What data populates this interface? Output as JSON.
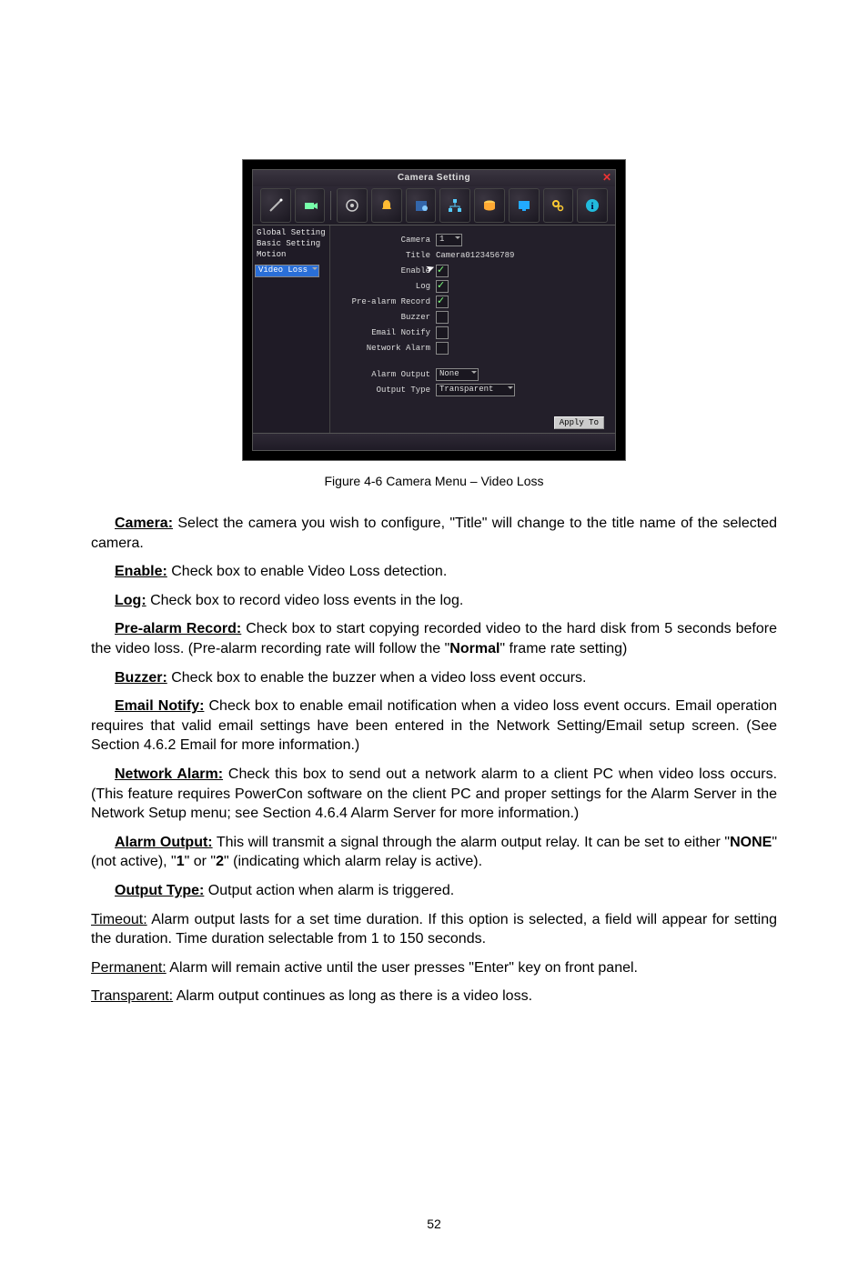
{
  "screenshot": {
    "title": "Camera Setting",
    "sidebar": [
      "Global Setting",
      "Basic Setting",
      "Motion",
      "Video Loss"
    ],
    "selectedSidebar": 3,
    "fields": {
      "camera_lbl": "Camera",
      "camera_val": "1",
      "title_lbl": "Title",
      "title_val": "Camera0123456789",
      "enable_lbl": "Enable",
      "log_lbl": "Log",
      "prealarm_lbl": "Pre-alarm Record",
      "buzzer_lbl": "Buzzer",
      "email_lbl": "Email Notify",
      "netalarm_lbl": "Network Alarm",
      "alarmout_lbl": "Alarm Output",
      "alarmout_val": "None",
      "outtype_lbl": "Output Type",
      "outtype_val": "Transparent",
      "apply": "Apply To"
    }
  },
  "caption": "Figure 4-6 Camera Menu – Video Loss",
  "para": {
    "camera_lbl": "Camera:",
    "camera_txt": " Select the camera you wish to configure, \"Title\" will change to the title name of the selected camera.",
    "enable_lbl": "Enable:",
    "enable_txt": " Check box to enable Video Loss detection.",
    "log_lbl": "Log:",
    "log_txt": " Check box to record video loss events in the log.",
    "pre_lbl": "Pre-alarm Record:",
    "pre_txt_a": " Check box to start copying recorded video to the hard disk from 5 seconds before the video loss. (Pre-alarm recording rate will follow the \"",
    "pre_txt_b": "Normal",
    "pre_txt_c": "\" frame rate setting)",
    "buz_lbl": "Buzzer:",
    "buz_txt": " Check box to enable the buzzer when a video loss event occurs.",
    "em_lbl": "Email Notify:",
    "em_txt": " Check box to enable email notification when a video loss event occurs. Email operation requires that valid email settings have been entered in the Network Setting/Email setup screen. (See Section 4.6.2 Email for more information.)",
    "na_lbl": "Network Alarm:",
    "na_txt": " Check this box to send out a network alarm to a client PC when video loss occurs. (This feature requires PowerCon software on the client PC and proper settings for the Alarm Server in the Network Setup menu; see Section 4.6.4 Alarm Server for more information.)",
    "ao_lbl": "Alarm Output:",
    "ao_txt_a": " This will transmit a signal through the alarm output relay. It can be set to either \"",
    "ao_txt_b": "NONE",
    "ao_txt_c": "\" (not active), \"",
    "ao_txt_d": "1",
    "ao_txt_e": "\" or \"",
    "ao_txt_f": "2",
    "ao_txt_g": "\" (indicating which alarm relay is active).",
    "ot_lbl": "Output Type:",
    "ot_txt": " Output action when alarm is triggered.",
    "to_lbl": "Timeout:",
    "to_txt": " Alarm output lasts for a set time duration. If this option is selected, a field will appear for setting the duration. Time duration selectable from 1 to 150 seconds.",
    "pm_lbl": "Permanent:",
    "pm_txt_a": " Alarm will remain active until the user presses \"",
    "pm_txt_b": "Enter",
    "pm_txt_c": "\" key on front panel.",
    "tr_lbl": "Transparent:",
    "tr_txt": " Alarm output continues as long as there is a video loss."
  },
  "pagenum": "52"
}
